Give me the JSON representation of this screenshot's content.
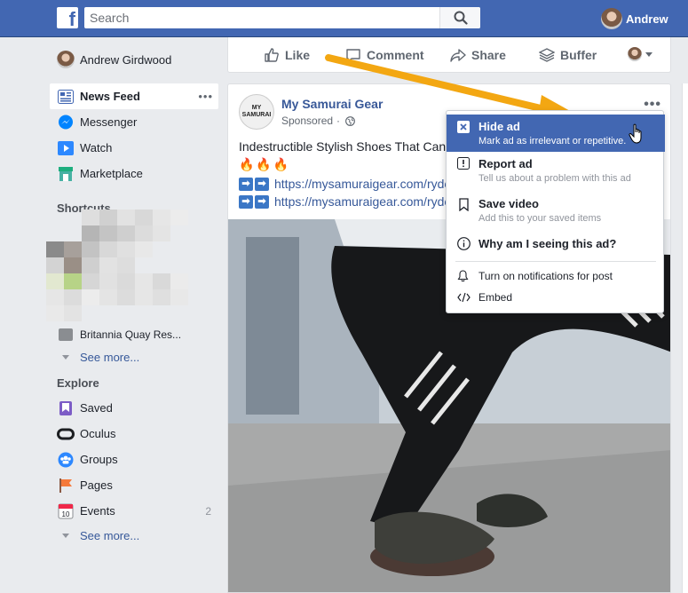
{
  "topbar": {
    "logo": "f",
    "search_placeholder": "Search",
    "user_name": "Andrew"
  },
  "leftnav": {
    "profile_name": "Andrew Girdwood",
    "items": [
      {
        "label": "News Feed",
        "icon": "news-feed-icon",
        "active": true
      },
      {
        "label": "Messenger",
        "icon": "messenger-icon"
      },
      {
        "label": "Watch",
        "icon": "watch-icon"
      },
      {
        "label": "Marketplace",
        "icon": "marketplace-icon"
      }
    ],
    "more_dots": "•••",
    "shortcuts_title": "Shortcuts",
    "shortcut_partial": "Britannia Quay Res...",
    "see_more_1": "See more...",
    "explore_title": "Explore",
    "explore_items": [
      {
        "label": "Saved",
        "icon": "saved-icon"
      },
      {
        "label": "Oculus",
        "icon": "oculus-icon"
      },
      {
        "label": "Groups",
        "icon": "groups-icon"
      },
      {
        "label": "Pages",
        "icon": "pages-icon"
      },
      {
        "label": "Events",
        "icon": "events-icon",
        "count": "2",
        "calendar_day": "10"
      }
    ],
    "see_more_2": "See more..."
  },
  "actionbar": {
    "like": "Like",
    "comment": "Comment",
    "share": "Share",
    "buffer": "Buffer"
  },
  "post": {
    "page_name": "My Samurai Gear",
    "avatar_text": "MY SAMURAI",
    "sponsored": "Sponsored",
    "dot": "·",
    "options": "•••",
    "text": "Indestructible Stylish Shoes That Can",
    "emojis": "🔥🔥🔥",
    "links": [
      "https://mysamuraigear.com/ryde",
      "https://mysamuraigear.com/ryde"
    ]
  },
  "menu": {
    "items": [
      {
        "title": "Hide ad",
        "subtitle": "Mark ad as irrelevant or repetitive.",
        "icon": "hide-icon",
        "highlighted": true
      },
      {
        "title": "Report ad",
        "subtitle": "Tell us about a problem with this ad",
        "icon": "report-icon"
      },
      {
        "title": "Save video",
        "subtitle": "Add this to your saved items",
        "icon": "bookmark-icon"
      },
      {
        "title": "Why am I seeing this ad?",
        "subtitle": "",
        "icon": "info-icon"
      }
    ],
    "small_items": [
      {
        "label": "Turn on notifications for post",
        "icon": "bell-icon"
      },
      {
        "label": "Embed",
        "icon": "code-icon"
      }
    ]
  },
  "colors": {
    "brand": "#4267b2",
    "link": "#365899",
    "annotation_arrow": "#f3a712"
  }
}
